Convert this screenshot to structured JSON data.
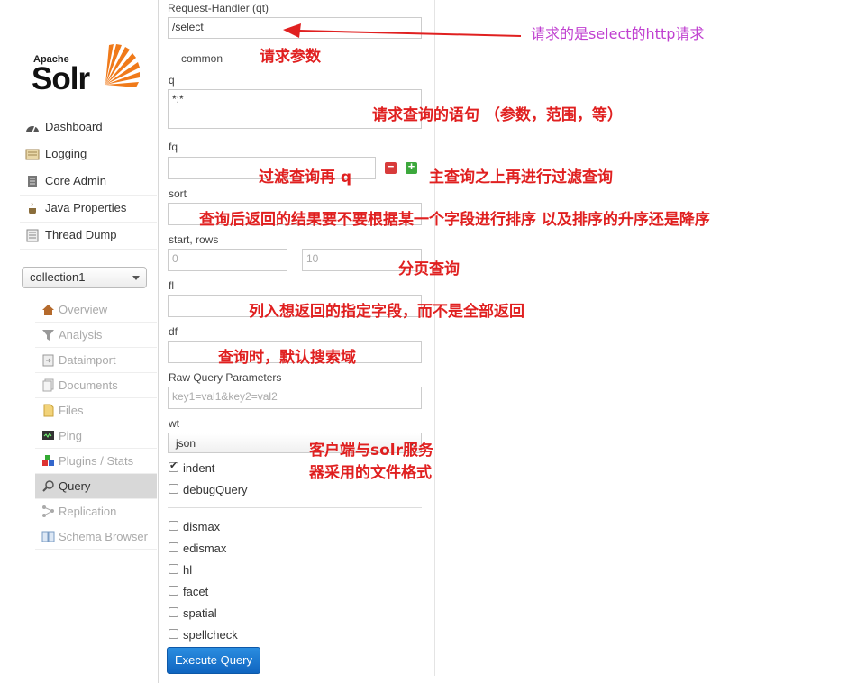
{
  "logo": {
    "apache": "Apache",
    "solr": "Solr"
  },
  "nav": [
    {
      "label": "Dashboard",
      "icon": "dashboard-icon"
    },
    {
      "label": "Logging",
      "icon": "logging-icon"
    },
    {
      "label": "Core Admin",
      "icon": "core-admin-icon"
    },
    {
      "label": "Java Properties",
      "icon": "java-icon"
    },
    {
      "label": "Thread Dump",
      "icon": "thread-dump-icon"
    }
  ],
  "core_selector": {
    "value": "collection1"
  },
  "core_nav": [
    {
      "label": "Overview",
      "icon": "home-icon"
    },
    {
      "label": "Analysis",
      "icon": "funnel-icon"
    },
    {
      "label": "Dataimport",
      "icon": "dataimport-icon"
    },
    {
      "label": "Documents",
      "icon": "documents-icon"
    },
    {
      "label": "Files",
      "icon": "files-icon"
    },
    {
      "label": "Ping",
      "icon": "ping-icon"
    },
    {
      "label": "Plugins / Stats",
      "icon": "plugins-icon"
    },
    {
      "label": "Query",
      "icon": "query-icon"
    },
    {
      "label": "Replication",
      "icon": "replication-icon"
    },
    {
      "label": "Schema Browser",
      "icon": "schema-icon"
    }
  ],
  "form": {
    "qt_label": "Request-Handler (qt)",
    "qt_value": "/select",
    "common_legend": "common",
    "q_label": "q",
    "q_value": "*:*",
    "fq_label": "fq",
    "sort_label": "sort",
    "start_rows_label": "start, rows",
    "start_placeholder": "0",
    "rows_placeholder": "10",
    "fl_label": "fl",
    "df_label": "df",
    "raw_label": "Raw Query Parameters",
    "raw_placeholder": "key1=val1&key2=val2",
    "wt_label": "wt",
    "wt_value": "json",
    "checkboxes_top": [
      {
        "label": "indent",
        "checked": true
      },
      {
        "label": "debugQuery",
        "checked": false
      }
    ],
    "checkboxes_bottom": [
      {
        "label": "dismax",
        "checked": false
      },
      {
        "label": "edismax",
        "checked": false
      },
      {
        "label": "hl",
        "checked": false
      },
      {
        "label": "facet",
        "checked": false
      },
      {
        "label": "spatial",
        "checked": false
      },
      {
        "label": "spellcheck",
        "checked": false
      }
    ],
    "execute_label": "Execute Query"
  },
  "annotations": {
    "qt": "请求的是select的http请求",
    "qt_params": "请求参数",
    "q": "请求查询的语句  （参数，范围，等）",
    "fq_left": "过滤查询再 q",
    "fq_right": "主查询之上再进行过滤查询",
    "sort": "查询后返回的结果要不要根据某一个字段进行排序 以及排序的升序还是降序",
    "paging": "分页查询",
    "fl": "列入想返回的指定字段，而不是全部返回",
    "df": "查询时，默认搜索域",
    "wt_line1": "客户端与solr服务",
    "wt_line2": "器采用的文件格式"
  },
  "colors": {
    "annotation_red": "#e02020",
    "annotation_purple": "#c040d0",
    "button_blue": "#1a78d0"
  }
}
